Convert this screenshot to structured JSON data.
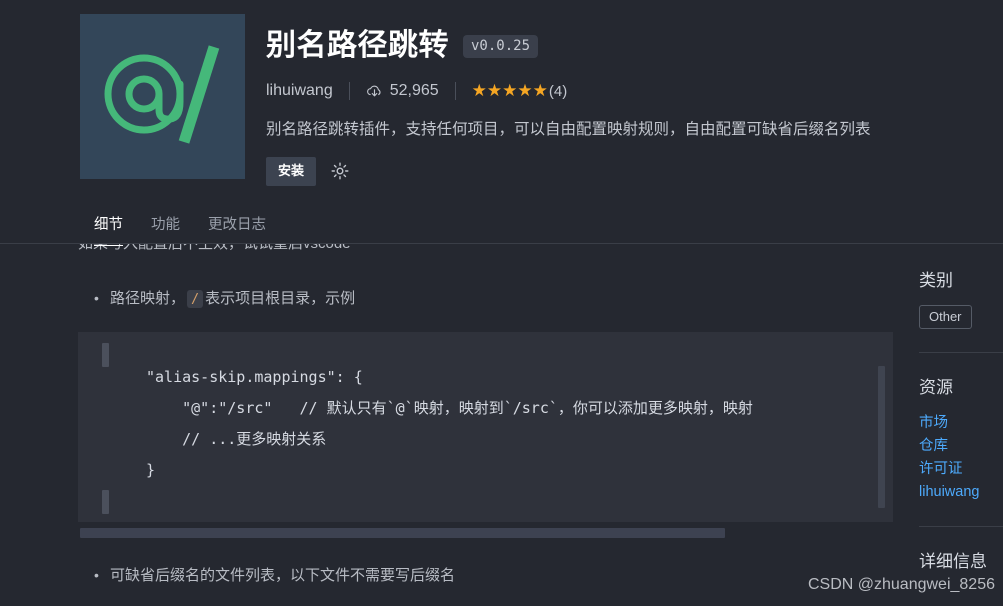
{
  "header": {
    "icon_name": "at-slash-icon",
    "icon_bg": "#334659",
    "icon_fg": "#45b87a",
    "title": "别名路径跳转",
    "version": "v0.0.25",
    "publisher": "lihuiwang",
    "installs_icon": "cloud-download-icon",
    "installs": "52,965",
    "stars": "★★★★★",
    "rating_count": "(4)",
    "star_color": "#f5a623",
    "description": "别名路径跳转插件，支持任何项目，可以自由配置映射规则，自由配置可缺省后缀名列表",
    "install_label": "安装",
    "gear_icon": "gear-icon"
  },
  "tabs": [
    {
      "label": "细节",
      "active": true
    },
    {
      "label": "功能",
      "active": false
    },
    {
      "label": "更改日志",
      "active": false
    }
  ],
  "body": {
    "clipped_line": "如果写入配置后不生效，试试重启vscode",
    "bullet_1_before": "路径映射，",
    "bullet_1_code": "/",
    "bullet_1_after": "表示项目根目录，示例",
    "bullet_2": "可缺省后缀名的文件列表，以下文件不需要写后缀名",
    "code": {
      "line_1": "\"alias-skip.mappings\": {",
      "line_2": "    \"@\":\"/src\"   // 默认只有`@`映射，映射到`/src`，你可以添加更多映射，映射",
      "line_3": "    // ...更多映射关系",
      "line_4": "}"
    }
  },
  "sidebar": {
    "category_heading": "类别",
    "category_badge": "Other",
    "resources_heading": "资源",
    "resources": [
      {
        "label": "市场"
      },
      {
        "label": "仓库"
      },
      {
        "label": "许可证"
      },
      {
        "label": "lihuiwang"
      }
    ],
    "details_heading": "详细信息",
    "link_color": "#4daafc"
  },
  "watermark": "CSDN @zhuangwei_8256"
}
